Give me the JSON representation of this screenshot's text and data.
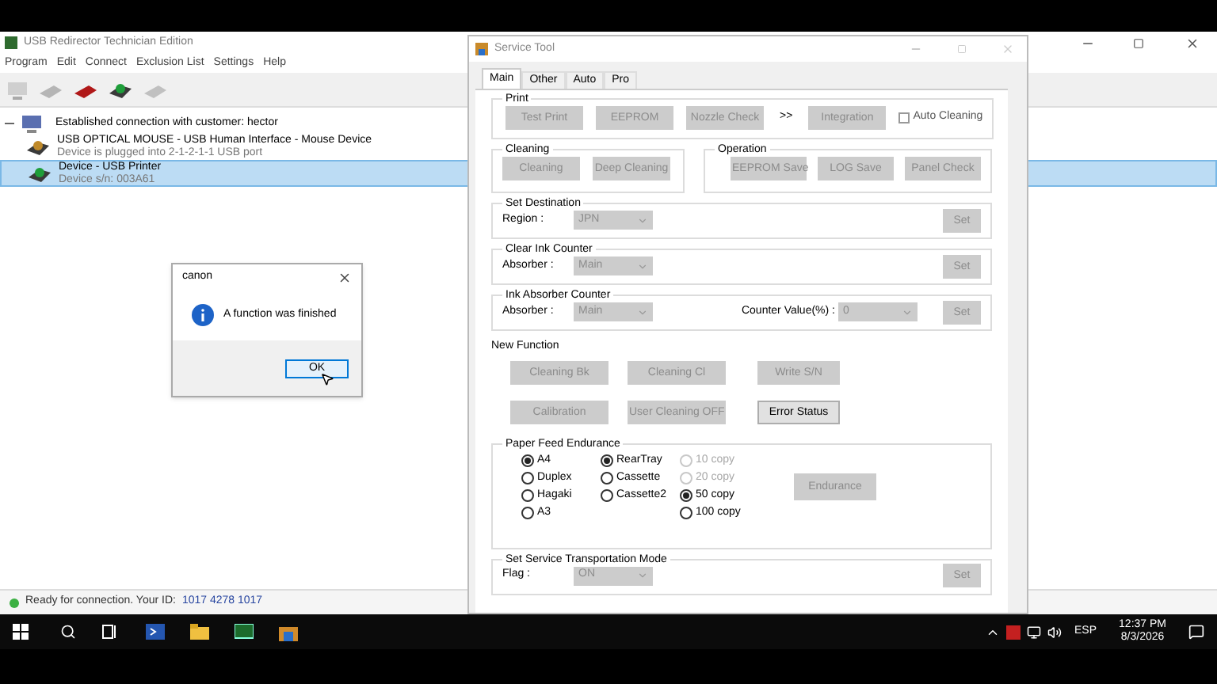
{
  "main_window": {
    "title": "USB Redirector Technician Edition",
    "menu": [
      "Program",
      "Edit",
      "Connect",
      "Exclusion List",
      "Settings",
      "Help"
    ],
    "tree": {
      "label": "Established connection with customer: hector",
      "expanded": true,
      "children": [
        {
          "title": "USB OPTICAL MOUSE - USB Human Interface - Mouse Device",
          "subtitle": "Device is plugged into 2-1-2-1-1 USB port",
          "selected": false
        },
        {
          "title": "Device - USB Printer",
          "subtitle": "Device s/n: 003A61",
          "selected": true
        }
      ]
    },
    "status": {
      "text": "Ready for connection. Your ID:",
      "id": "1017 4278 1017"
    }
  },
  "dialog": {
    "title": "canon",
    "message": "A function was finished",
    "button": "OK"
  },
  "service_tool": {
    "title": "Service Tool",
    "tabs": [
      {
        "label": "Main",
        "selected": true
      },
      {
        "label": "Other",
        "selected": false
      },
      {
        "label": "Auto",
        "selected": false
      },
      {
        "label": "Pro",
        "selected": false
      }
    ],
    "print": {
      "label": "Print",
      "items": [
        {
          "kind": "button",
          "label": "Test Print",
          "disabled": true
        },
        {
          "kind": "button",
          "label": "EEPROM",
          "disabled": true
        },
        {
          "kind": "button",
          "label": "Nozzle Check",
          "disabled": true
        },
        {
          "kind": "text",
          "label": ">>"
        },
        {
          "kind": "button",
          "label": "Integration",
          "disabled": true
        },
        {
          "kind": "checkbox",
          "label": "Auto Cleaning",
          "checked": false
        }
      ]
    },
    "cleaning": {
      "label": "Cleaning",
      "buttons": [
        {
          "label": "Cleaning",
          "disabled": true
        },
        {
          "label": "Deep Cleaning",
          "disabled": true
        }
      ]
    },
    "operation": {
      "label": "Operation",
      "buttons": [
        {
          "label": "EEPROM Save",
          "disabled": true
        },
        {
          "label": "LOG Save",
          "disabled": true
        },
        {
          "label": "Panel Check",
          "disabled": true
        }
      ]
    },
    "set_destination": {
      "label": "Set Destination",
      "field_label": "Region :",
      "value": "JPN",
      "button": {
        "label": "Set",
        "disabled": true
      }
    },
    "clear_ink_counter": {
      "label": "Clear Ink Counter",
      "field_label": "Absorber :",
      "value": "Main",
      "button": {
        "label": "Set",
        "disabled": true
      }
    },
    "ink_absorber_counter": {
      "label": "Ink Absorber Counter",
      "field_label": "Absorber :",
      "value": "Main",
      "counter_label": "Counter Value(%) :",
      "counter_value": "0",
      "button": {
        "label": "Set",
        "disabled": true
      }
    },
    "new_function": {
      "label": "New Function",
      "rows": [
        [
          {
            "label": "Cleaning Bk",
            "disabled": true
          },
          {
            "label": "Cleaning Cl",
            "disabled": true
          },
          {
            "label": "Write S/N",
            "disabled": true
          }
        ],
        [
          {
            "label": "Calibration",
            "disabled": true
          },
          {
            "label": "User Cleaning OFF",
            "disabled": true
          },
          {
            "label": "Error Status",
            "disabled": false
          }
        ]
      ]
    },
    "paper_feed_endurance": {
      "label": "Paper Feed Endurance",
      "columns": [
        [
          {
            "label": "A4",
            "selected": true,
            "disabled": false
          },
          {
            "label": "Duplex",
            "selected": false,
            "disabled": false
          },
          {
            "label": "Hagaki",
            "selected": false,
            "disabled": false
          },
          {
            "label": "A3",
            "selected": false,
            "disabled": false
          }
        ],
        [
          {
            "label": "RearTray",
            "selected": true,
            "disabled": false
          },
          {
            "label": "Cassette",
            "selected": false,
            "disabled": false
          },
          {
            "label": "Cassette2",
            "selected": false,
            "disabled": false
          }
        ],
        [
          {
            "label": "10 copy",
            "selected": false,
            "disabled": true
          },
          {
            "label": "20 copy",
            "selected": false,
            "disabled": true
          },
          {
            "label": "50 copy",
            "selected": true,
            "disabled": false
          },
          {
            "label": "100 copy",
            "selected": false,
            "disabled": false
          }
        ]
      ],
      "button": {
        "label": "Endurance",
        "disabled": true
      }
    },
    "transportation_mode": {
      "label": "Set Service Transportation Mode",
      "field_label": "Flag :",
      "value": "ON",
      "button": {
        "label": "Set",
        "disabled": true
      }
    }
  },
  "taskbar": {
    "language": "ESP",
    "time": "12:37 PM",
    "date": "8/3/2026"
  }
}
